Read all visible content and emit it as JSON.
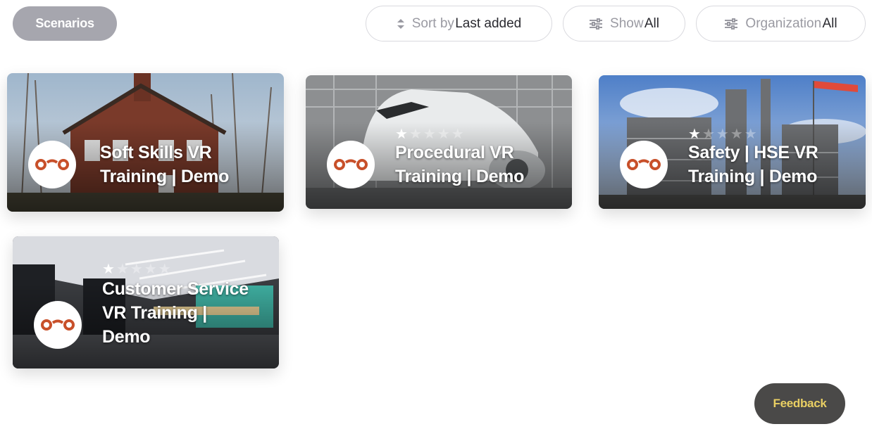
{
  "toolbar": {
    "scenarios_label": "Scenarios",
    "sort": {
      "label": "Sort by",
      "value": "Last added",
      "icon": "sort-arrows-icon"
    },
    "show": {
      "label": "Show",
      "value": "All",
      "icon": "sliders-icon"
    },
    "organization": {
      "label": "Organization",
      "value": "All",
      "icon": "sliders-icon"
    }
  },
  "cards": [
    {
      "title_line1": "Soft Skills VR",
      "title_line2": "Training | Demo",
      "title_line3": "",
      "rating": 0,
      "max_rating": 5,
      "scene": "brick house with bare trees"
    },
    {
      "title_line1": "Procedural VR",
      "title_line2": "Training | Demo",
      "title_line3": "",
      "rating": 1,
      "max_rating": 5,
      "scene": "airplane in hangar"
    },
    {
      "title_line1": "Safety | HSE VR",
      "title_line2": "Training | Demo",
      "title_line3": "",
      "rating": 1,
      "max_rating": 5,
      "scene": "industrial refinery"
    },
    {
      "title_line1": "Customer Service",
      "title_line2": "VR Training |",
      "title_line3": "Demo",
      "rating": 1,
      "max_rating": 5,
      "scene": "retail store interior"
    }
  ],
  "feedback_label": "Feedback",
  "colors": {
    "scenarios_bg": "#a6a6ae",
    "logo_orange": "#c8502a",
    "feedback_bg": "#4a4948",
    "feedback_text": "#e9cf63"
  }
}
